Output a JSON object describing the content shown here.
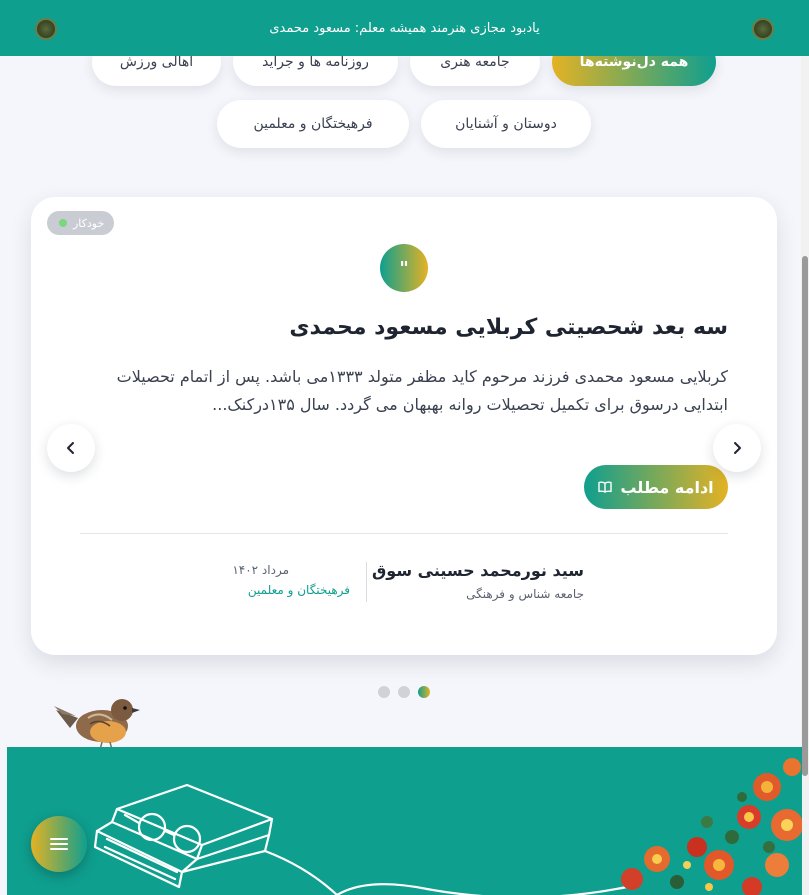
{
  "header": {
    "title": "یادبود مجازی هنرمند همیشه معلم: مسعود محمدی"
  },
  "filters": {
    "all": "همه دل‌نوشته‌ها",
    "art_community": "جامعه هنری",
    "newspapers": "روزنامه ها و جراید",
    "sports": "اهالی ورزش",
    "friends": "دوستان و آشنایان",
    "teachers": "فرهیختگان و معلمین"
  },
  "card": {
    "badge": "خودکار",
    "quote_mark": "\"",
    "title": "سه بعد شحصیتی کربلایی مسعود محمدی",
    "excerpt": "کربلایی مسعود محمدی فرزند مرحوم کاید مظفر متولد ۱۳۳۳می باشد. پس از اتمام تحصیلات ابتدایی درسوق برای تکمیل تحصیلات روانه بهبهان می گردد. سال ۱۳۵درکنک...",
    "read_more": "ادامه مطلب",
    "author_name": "سید نورمحمد حسینی سوق",
    "author_role": "جامعه شناس و فرهنگی",
    "date": "مرداد ۱۴۰۲",
    "category": "فرهیختگان و معلمین"
  },
  "icons": {
    "left_arrow": "chevron-left-icon",
    "right_arrow": "chevron-right-icon",
    "menu": "hamburger-menu-icon",
    "book": "book-icon"
  },
  "colors": {
    "primary": "#0f9f8f",
    "accent": "#e4b224"
  }
}
